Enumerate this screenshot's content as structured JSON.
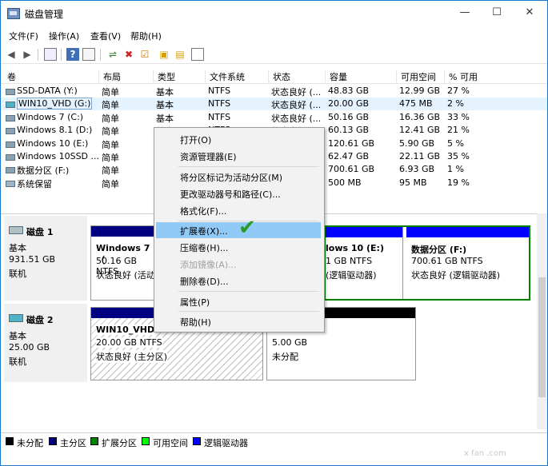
{
  "title": "磁盘管理",
  "window_buttons": {
    "min": "—",
    "max": "☐",
    "close": "✕"
  },
  "menu": [
    "文件(F)",
    "操作(A)",
    "查看(V)",
    "帮助(H)"
  ],
  "columns": [
    "卷",
    "布局",
    "类型",
    "文件系统",
    "状态",
    "容量",
    "可用空间",
    "% 可用"
  ],
  "volumes": [
    [
      "SSD-DATA (Y:)",
      "简单",
      "基本",
      "NTFS",
      "状态良好 (...",
      "48.83 GB",
      "12.99 GB",
      "27 %"
    ],
    [
      "WIN10_VHD (G:)",
      "简单",
      "基本",
      "NTFS",
      "状态良好 (...",
      "20.00 GB",
      "475 MB",
      "2 %"
    ],
    [
      "Windows 7 (C:)",
      "简单",
      "基本",
      "NTFS",
      "状态良好 (...",
      "50.16 GB",
      "16.36 GB",
      "33 %"
    ],
    [
      "Windows 8.1 (D:)",
      "简单",
      "基本",
      "NTFS",
      "状态良好 (...",
      "60.13 GB",
      "12.41 GB",
      "21 %"
    ],
    [
      "Windows 10 (E:)",
      "简单",
      "基本",
      "NTFS",
      "状态良好 (...",
      "120.61 GB",
      "5.90 GB",
      "5 %"
    ],
    [
      "Windows 10SSD ...",
      "简单",
      "基本",
      "NTFS",
      "状态良好 (...",
      "62.47 GB",
      "22.11 GB",
      "35 %"
    ],
    [
      "数据分区 (F:)",
      "简单",
      "基本",
      "NTFS",
      "状态良好 (...",
      "700.61 GB",
      "6.93 GB",
      "1 %"
    ],
    [
      "系统保留",
      "简单",
      "基本",
      "NTFS",
      "状态良好 (...",
      "500 MB",
      "95 MB",
      "19 %"
    ]
  ],
  "disk1": {
    "name": "磁盘 1",
    "type": "基本",
    "size": "931.51 GB",
    "status": "联机"
  },
  "disk2": {
    "name": "磁盘 2",
    "type": "基本",
    "size": "25.00 GB",
    "status": "联机"
  },
  "parts": {
    "win7": {
      "name": "Windows 7 （",
      "size": "50.16 GB NTFS",
      "status": "状态良好 (活动"
    },
    "win10": {
      "name": "lows 10 (E:)",
      "size": "1 GB NTFS",
      "status": "(逻辑驱动器)"
    },
    "data": {
      "name": "数据分区 (F:)",
      "size": "700.61 GB NTFS",
      "status": "状态良好 (逻辑驱动器)"
    },
    "vhd": {
      "name": "WIN10_VHD",
      "size": "20.00 GB NTFS",
      "status": "状态良好 (主分区)"
    },
    "unalloc": {
      "size": "5.00 GB",
      "status": "未分配"
    }
  },
  "context_menu": [
    "打开(O)",
    "资源管理器(E)",
    "将分区标记为活动分区(M)",
    "更改驱动器号和路径(C)...",
    "格式化(F)...",
    "扩展卷(X)...",
    "压缩卷(H)...",
    "添加镜像(A)...",
    "删除卷(D)...",
    "属性(P)",
    "帮助(H)"
  ],
  "legend": [
    "未分配",
    "主分区",
    "扩展分区",
    "可用空间",
    "逻辑驱动器"
  ],
  "colors": {
    "unallocated": "#000000",
    "primary": "#000080",
    "extended": "#008000",
    "free": "#00ff00",
    "logical": "#0000ff",
    "highlight": "#91c9f7"
  },
  "watermark": "x fan .com"
}
